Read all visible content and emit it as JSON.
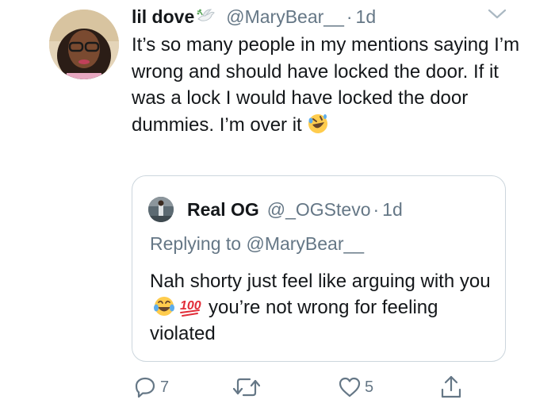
{
  "tweet": {
    "display_name": "lil dove",
    "handle": "@MaryBear__",
    "separator": "·",
    "time": "1d",
    "text": "It’s so many people in my mentions saying I’m wrong and should have locked the door. If it was a lock I would have locked the door dummies. I’m over it",
    "emoji": "rolling-on-floor-laughing"
  },
  "quoted": {
    "display_name": "Real OG",
    "handle": "@_OGStevo",
    "separator": "·",
    "time": "1d",
    "replying_prefix": "Replying to",
    "replying_handle": "@MaryBear__",
    "text_part1": "Nah shorty just feel like arguing with you",
    "text_part2": "you’re not wrong for feeling violated"
  },
  "actions": {
    "reply_count": "7",
    "retweet_count": "",
    "like_count": "5"
  },
  "colors": {
    "text": "#14171a",
    "secondary": "#657786",
    "border": "#ccd6dd"
  }
}
